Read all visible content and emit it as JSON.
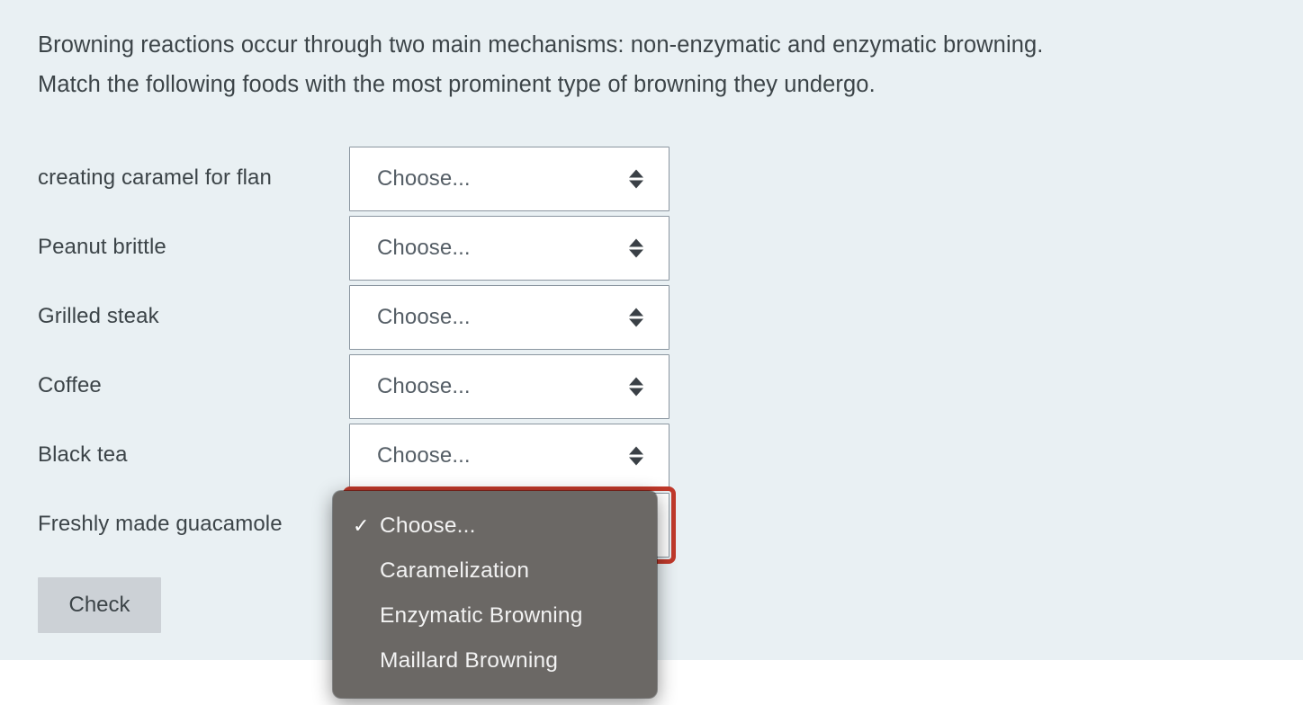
{
  "panel": {
    "background_color": "#e9f0f3",
    "prompt": "Browning reactions occur through two main mechanisms: non-enzymatic and enzymatic browning.\nMatch the following foods with the most prominent type of browning they undergo."
  },
  "match_rows": [
    {
      "label": "creating caramel for flan",
      "selected": "Choose...",
      "focused": false
    },
    {
      "label": "Peanut brittle",
      "selected": "Choose...",
      "focused": false
    },
    {
      "label": "Grilled steak",
      "selected": "Choose...",
      "focused": false
    },
    {
      "label": "Coffee",
      "selected": "Choose...",
      "focused": false
    },
    {
      "label": "Black tea",
      "selected": "Choose...",
      "focused": false
    },
    {
      "label": "Freshly made guacamole",
      "selected": "Choose...",
      "focused": true
    }
  ],
  "select": {
    "placeholder": "Choose...",
    "arrow_icon": "up-down-chevron-icon",
    "border_color": "#8b96a0",
    "focus_ring_color": "#c0392b"
  },
  "dropdown": {
    "open": true,
    "for_row": "Freshly made guacamole",
    "background_color": "#6b6865",
    "selected_value": "Choose...",
    "check_glyph": "✓",
    "options": [
      {
        "label": "Choose...",
        "checked": true
      },
      {
        "label": "Caramelization",
        "checked": false
      },
      {
        "label": "Enzymatic Browning",
        "checked": false
      },
      {
        "label": "Maillard Browning",
        "checked": false
      }
    ]
  },
  "check_button": {
    "label": "Check",
    "background_color": "#ccd1d6"
  }
}
